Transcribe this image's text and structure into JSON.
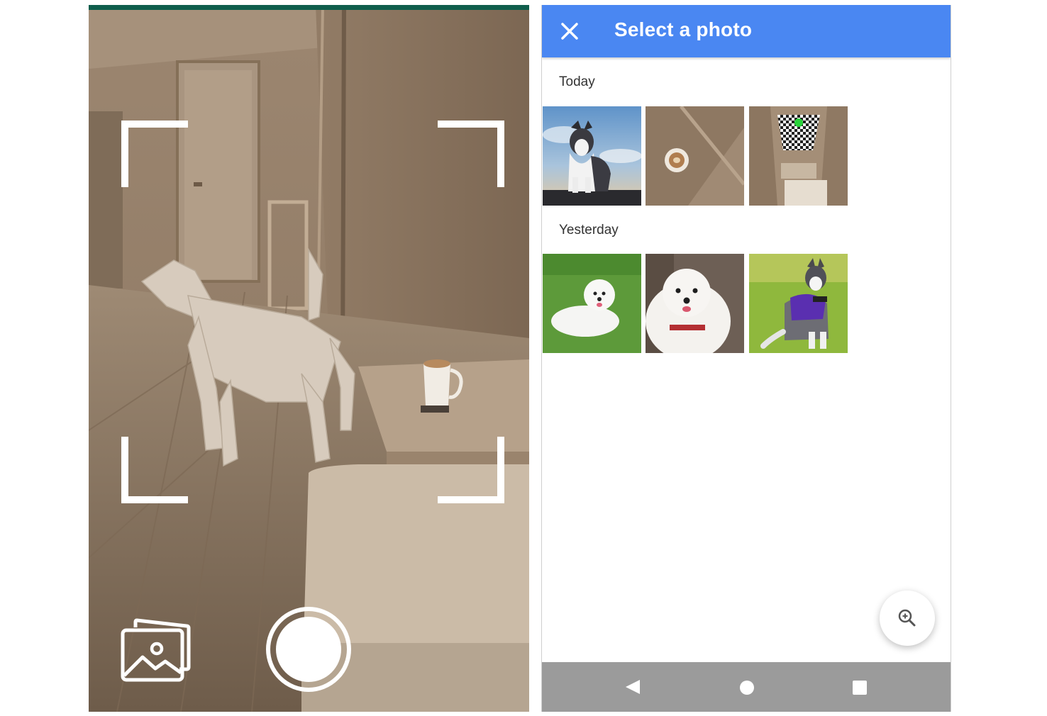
{
  "camera": {
    "icons": {
      "gallery": "gallery-icon",
      "shutter": "shutter-icon"
    },
    "frame_color": "#ffffff",
    "status_bar_color": "#0f5e4c"
  },
  "picker": {
    "title": "Select a photo",
    "close_icon": "close-icon",
    "accent_color": "#4a87f2",
    "sections": [
      {
        "label": "Today",
        "photos": [
          "husky-photo",
          "coffee-cup-photo",
          "room-ceiling-photo"
        ]
      },
      {
        "label": "Yesterday",
        "photos": [
          "white-dog-lying-photo",
          "white-dog-portrait-photo",
          "husky-with-harness-photo"
        ]
      }
    ],
    "fab_icon": "zoom-in-icon",
    "navbar": {
      "color": "#9b9b9b",
      "icons": [
        "back-icon",
        "home-icon",
        "recents-icon"
      ]
    }
  }
}
